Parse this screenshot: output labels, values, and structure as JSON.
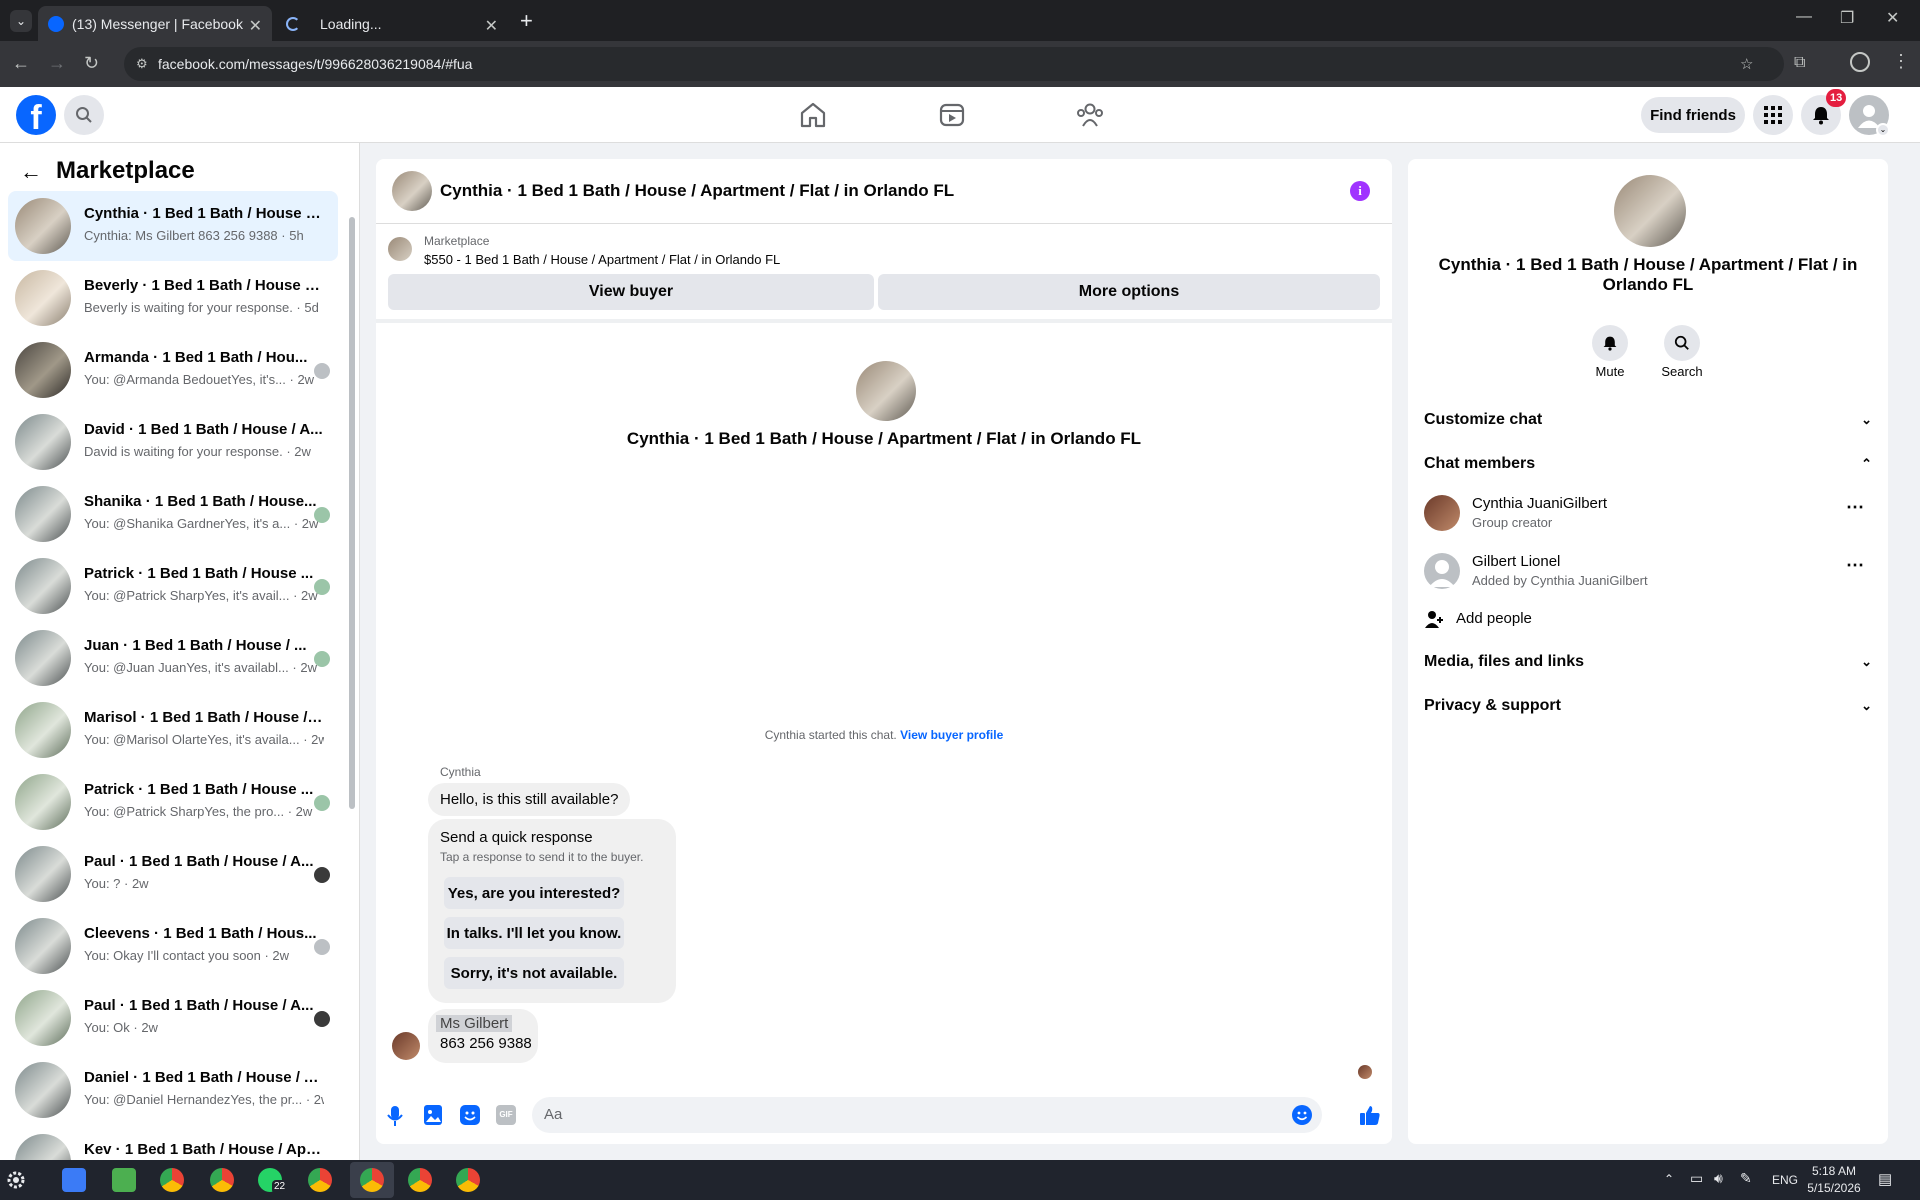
{
  "browser": {
    "tabs": [
      {
        "title": "(13) Messenger | Facebook"
      },
      {
        "title": "Loading..."
      }
    ],
    "url": "facebook.com/messages/t/996628036219084/#fua"
  },
  "header": {
    "find_friends": "Find friends",
    "notification_count": "13"
  },
  "sidebar": {
    "title": "Marketplace",
    "conversations": [
      {
        "name": "Cynthia · 1 Bed 1 Bath / House / ...",
        "snippet": "Cynthia: Ms Gilbert 863 256 9388 · 5h"
      },
      {
        "name": "Beverly · 1 Bed 1 Bath / House / ...",
        "snippet": "Beverly is waiting for your response. · 5d"
      },
      {
        "name": "Armanda · 1 Bed 1 Bath / Hou...",
        "snippet": "You: @Armanda BedouetYes, it's... · 2w"
      },
      {
        "name": "David · 1 Bed 1 Bath / House / A...",
        "snippet": "David is waiting for your response. · 2w"
      },
      {
        "name": "Shanika · 1 Bed 1 Bath / House...",
        "snippet": "You: @Shanika GardnerYes, it's a... · 2w"
      },
      {
        "name": "Patrick · 1 Bed 1 Bath / House ...",
        "snippet": "You: @Patrick SharpYes, it's avail... · 2w"
      },
      {
        "name": "Juan · 1 Bed 1 Bath / House / ...",
        "snippet": "You: @Juan JuanYes, it's availabl... · 2w"
      },
      {
        "name": "Marisol · 1 Bed 1 Bath / House / ...",
        "snippet": "You: @Marisol OlarteYes, it's availa... · 2w"
      },
      {
        "name": "Patrick · 1 Bed 1 Bath / House ...",
        "snippet": "You: @Patrick SharpYes, the pro... · 2w"
      },
      {
        "name": "Paul · 1 Bed 1 Bath / House / A...",
        "snippet": "You: ? · 2w"
      },
      {
        "name": "Cleevens · 1 Bed 1 Bath / Hous...",
        "snippet": "You: Okay I'll contact you soon · 2w"
      },
      {
        "name": "Paul · 1 Bed 1 Bath / House / A...",
        "snippet": "You: Ok · 2w"
      },
      {
        "name": "Daniel · 1 Bed 1 Bath / House / A...",
        "snippet": "You: @Daniel HernandezYes, the pr... · 2w"
      },
      {
        "name": "Kev · 1 Bed 1 Bath / House / Apa...",
        "snippet": ""
      }
    ]
  },
  "chat": {
    "title": "Cynthia · 1 Bed 1 Bath / House / Apartment / Flat / in Orlando FL",
    "listing_label": "Marketplace",
    "listing_detail": "$550 - 1 Bed 1 Bath / House / Apartment / Flat / in Orlando FL",
    "view_buyer": "View buyer",
    "more_options": "More options",
    "center_title": "Cynthia · 1 Bed 1 Bath / House / Apartment / Flat / in Orlando FL",
    "started_text": "Cynthia started this chat.",
    "view_buyer_profile": "View buyer profile",
    "sender": "Cynthia",
    "message1": "Hello, is this still available?",
    "quick_title": "Send a quick response",
    "quick_sub": "Tap a response to send it to the buyer.",
    "quick_responses": [
      "Yes, are you interested?",
      "In talks. I'll let you know.",
      "Sorry, it's not available."
    ],
    "message2_line1": "Ms Gilbert",
    "message2_line2": "863 256 9388",
    "composer_placeholder": "Aa"
  },
  "info": {
    "title": "Cynthia · 1 Bed 1 Bath / House / Apartment / Flat / in Orlando FL",
    "mute": "Mute",
    "search": "Search",
    "customize": "Customize chat",
    "members": "Chat members",
    "member1_name": "Cynthia JuaniGilbert",
    "member1_role": "Group creator",
    "member2_name": "Gilbert Lionel",
    "member2_role": "Added by Cynthia JuaniGilbert",
    "add_people": "Add people",
    "media": "Media, files and links",
    "privacy": "Privacy & support"
  },
  "taskbar": {
    "whatsapp_badge": "22",
    "lang": "ENG",
    "time": "5:18 AM",
    "date": "5/15/2026"
  },
  "colors": {
    "fb_blue": "#0866ff",
    "selected_row": "#e7f3ff",
    "notif_red": "#e41e3f",
    "info_purple": "#a033ff"
  }
}
